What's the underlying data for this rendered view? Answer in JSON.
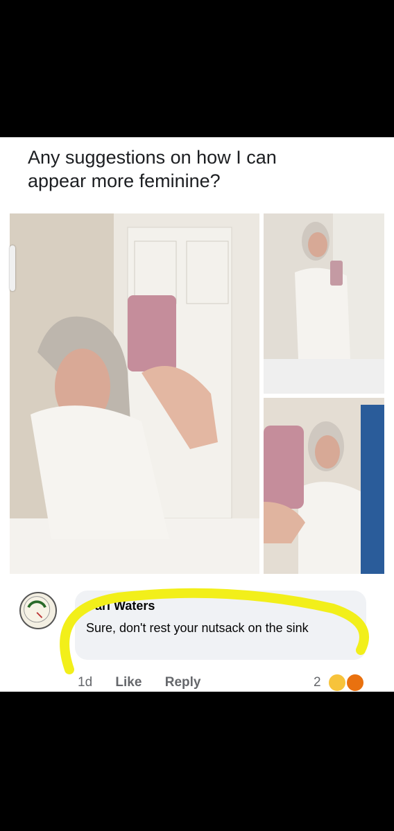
{
  "post": {
    "text": "Any suggestions on how I can appear more feminine?"
  },
  "comment": {
    "author": "Carl Waters",
    "text": "Sure, don't rest your nutsack on the sink",
    "time": "1d",
    "like_label": "Like",
    "reply_label": "Reply",
    "reaction_count": "2",
    "reactions": [
      "haha-icon",
      "angry-icon"
    ]
  },
  "colors": {
    "highlight": "#f2ef1a",
    "card_bg": "#ffffff",
    "page_bg": "#000000"
  }
}
